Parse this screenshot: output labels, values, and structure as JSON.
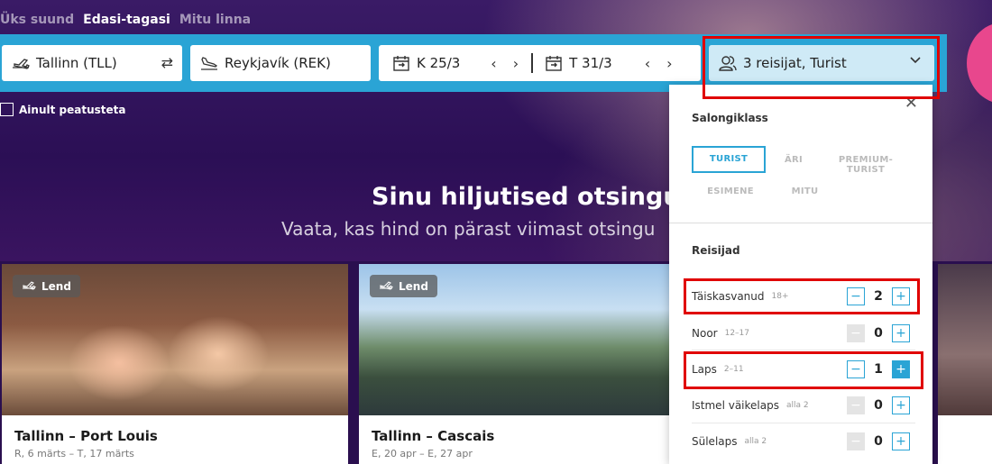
{
  "trip_tabs": [
    "Üks suund",
    "Edasi-tagasi",
    "Mitu linna"
  ],
  "search": {
    "origin": "Tallinn (TLL)",
    "destination": "Reykjavík (REK)",
    "depart_date": "K 25/3",
    "return_date": "T 31/3",
    "passengers": "3 reisijat, Turist"
  },
  "direct_only_label": "Ainult peatusteta",
  "recent": {
    "title": "Sinu hiljutised otsingu",
    "subtitle": "Vaata, kas hind on pärast viimast otsingu"
  },
  "cards": [
    {
      "badge": "Lend",
      "title": "Tallinn – Port Louis",
      "dates": "R, 6 märts – T, 17 märts"
    },
    {
      "badge": "Lend",
      "title": "Tallinn – Cascais",
      "dates": "E, 20 apr – E, 27 apr"
    }
  ],
  "panel": {
    "cabin_title": "Salongiklass",
    "cabin_classes": [
      "TURIST",
      "ÄRI",
      "PREMIUM-TURIST",
      "ESIMENE",
      "MITU"
    ],
    "selected_cabin": "TURIST",
    "travelers_title": "Reisijad",
    "travelers": [
      {
        "label": "Täiskasvanud",
        "age": "18+",
        "count": "2"
      },
      {
        "label": "Noor",
        "age": "12–17",
        "count": "0"
      },
      {
        "label": "Laps",
        "age": "2–11",
        "count": "1"
      },
      {
        "label": "Istmel väikelaps",
        "age": "alla 2",
        "count": "0"
      },
      {
        "label": "Sülelaps",
        "age": "alla 2",
        "count": "0"
      }
    ]
  },
  "colors": {
    "accent": "#2aa4d5",
    "highlight": "#e00000",
    "background": "#2a0f4f"
  }
}
